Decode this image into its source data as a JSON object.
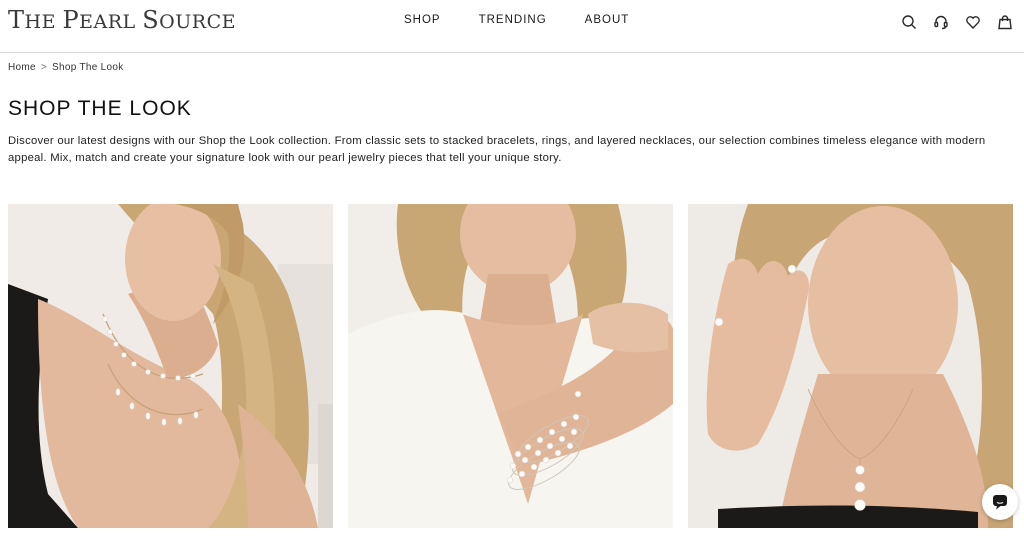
{
  "header": {
    "logo_first": "T",
    "logo_rest_1": "HE ",
    "logo_p": "P",
    "logo_rest_2": "EARL ",
    "logo_s": "S",
    "logo_rest_3": "OURCE",
    "nav": [
      "SHOP",
      "TRENDING",
      "ABOUT"
    ],
    "icons": [
      "search-icon",
      "headset-icon",
      "heart-icon",
      "bag-icon"
    ]
  },
  "breadcrumb": {
    "home": "Home",
    "separator": ">",
    "current": "Shop The Look"
  },
  "page": {
    "title": "SHOP THE LOOK",
    "description": "Discover our latest designs with our Shop the Look collection. From classic sets to stacked bracelets, rings, and layered necklaces, our selection combines timeless elegance with modern appeal. Mix, match and create your signature look with our pearl jewelry pieces that tell your unique story."
  },
  "gallery": [
    {
      "subject": "model-pearl-layered-necklace"
    },
    {
      "subject": "model-pearl-stacked-bracelets"
    },
    {
      "subject": "model-pearl-earrings-ring-pendant"
    }
  ],
  "colors": {
    "skin": "#e3b99d",
    "hair": "#c9a775",
    "background_photo": "#f1ede9",
    "top_white": "#f7f5f0",
    "top_black": "#1c1a19"
  },
  "chat": {
    "icon": "chat-icon"
  }
}
